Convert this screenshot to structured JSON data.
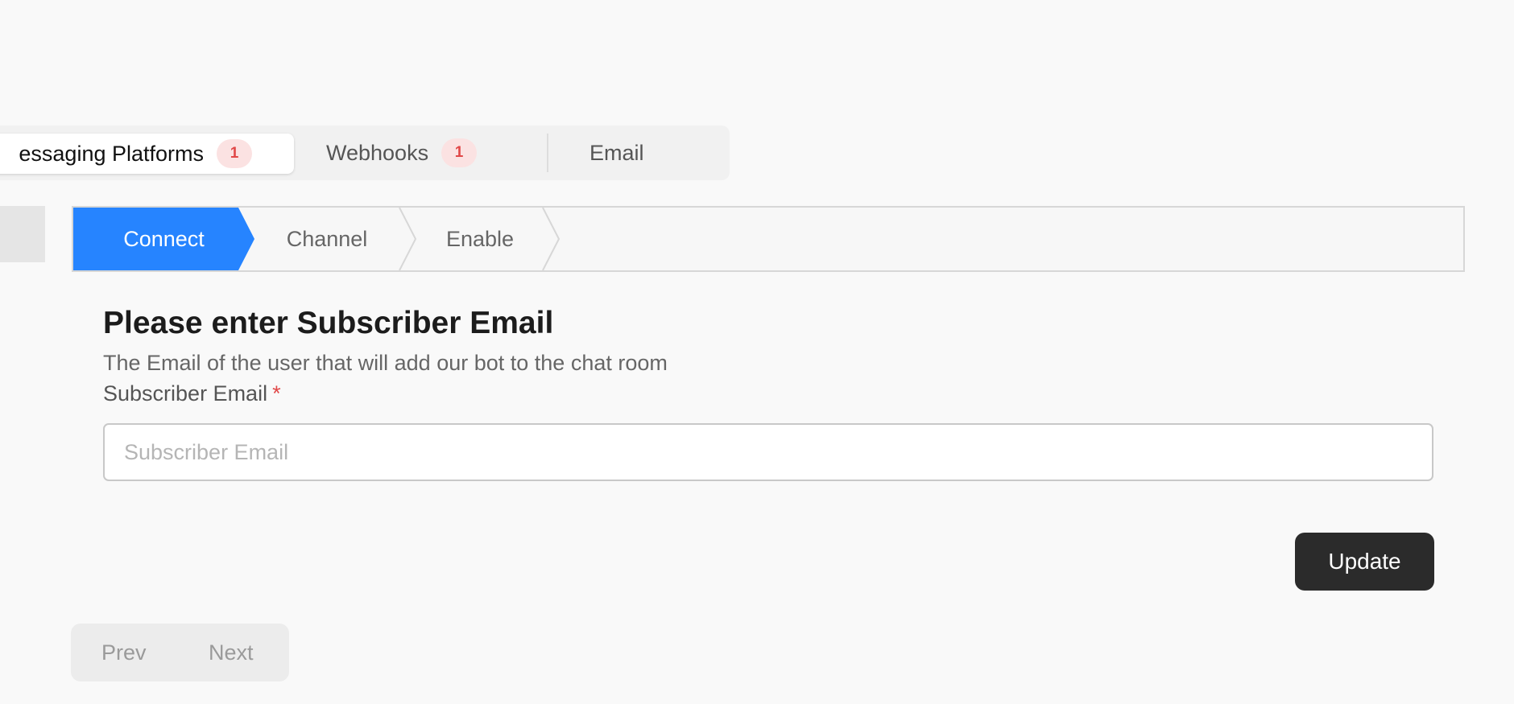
{
  "tabs": [
    {
      "label": "essaging Platforms",
      "badge": "1"
    },
    {
      "label": "Webhooks",
      "badge": "1"
    },
    {
      "label": "Email"
    }
  ],
  "stepper": {
    "steps": [
      "Connect",
      "Channel",
      "Enable"
    ],
    "active_step": "Connect",
    "active_color": "#2684ff"
  },
  "form": {
    "title": "Please enter Subscriber Email",
    "description": "The Email of the user that will add our bot to the chat room",
    "field_label": "Subscriber Email",
    "required_mark": "*",
    "input_value": "",
    "input_placeholder": "Subscriber Email",
    "submit_label": "Update"
  },
  "pager": {
    "prev_label": "Prev",
    "next_label": "Next"
  },
  "colors": {
    "badge_text": "#e14848",
    "badge_bg": "#fbe2e2",
    "button_bg": "#2b2b2b"
  }
}
